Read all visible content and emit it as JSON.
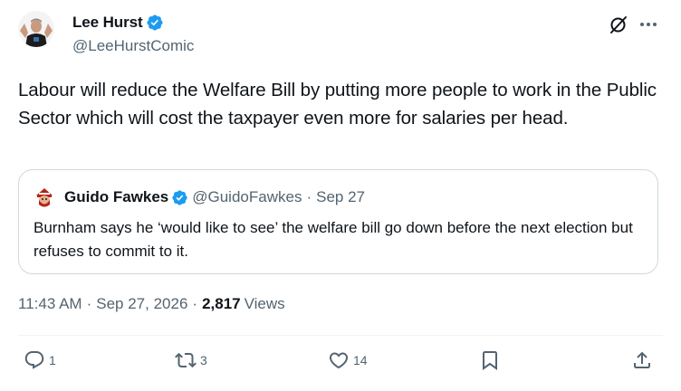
{
  "author": {
    "display_name": "Lee Hurst",
    "handle": "@LeeHurstComic"
  },
  "tweet": {
    "text": "Labour will reduce the Welfare Bill by putting more people to work in the Public Sector which will cost the taxpayer even more for salaries per head."
  },
  "quote": {
    "display_name": "Guido Fawkes",
    "handle": "@GuidoFawkes",
    "separator": "·",
    "date": "Sep 27",
    "text": "Burnham says he ‘would like to see’ the welfare bill go down before the next election but refuses to commit to it."
  },
  "meta": {
    "time": "11:43 AM",
    "separator": "·",
    "date": "Sep 27, 2026",
    "views_count": "2,817",
    "views_label": "Views"
  },
  "actions": {
    "replies": "1",
    "reposts": "3",
    "likes": "14"
  },
  "icons": {
    "verified": "verified-badge-icon",
    "grok": "grok-icon",
    "more": "more-icon",
    "reply": "reply-icon",
    "repost": "repost-icon",
    "like": "like-icon",
    "bookmark": "bookmark-icon",
    "share": "share-icon"
  },
  "colors": {
    "text": "#0f1419",
    "secondary": "#536471",
    "verified": "#1d9bf0",
    "border": "#cfd9de"
  }
}
